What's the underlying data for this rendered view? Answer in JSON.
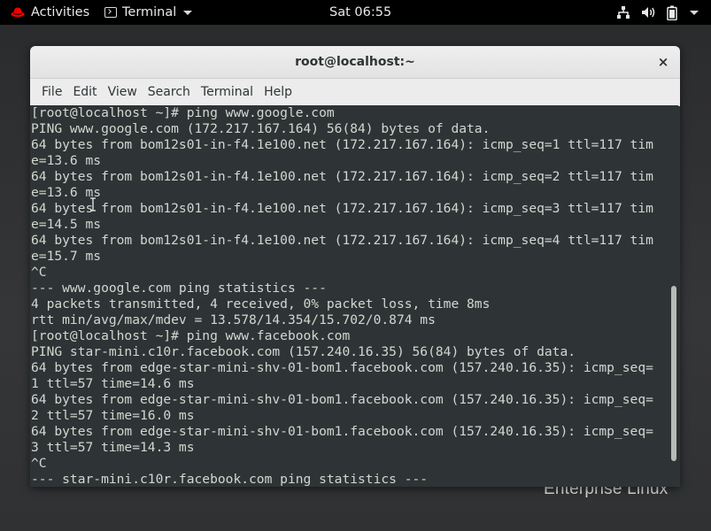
{
  "topbar": {
    "activities_label": "Activities",
    "app_label": "Terminal",
    "clock": "Sat 06:55",
    "icons": [
      "network-icon",
      "volume-icon",
      "battery-icon",
      "power-menu-caret-icon"
    ]
  },
  "window": {
    "title": "root@localhost:~",
    "close_label": "×",
    "menu": [
      "File",
      "Edit",
      "View",
      "Search",
      "Terminal",
      "Help"
    ]
  },
  "terminal": {
    "lines": [
      "[root@localhost ~]# ping www.google.com",
      "PING www.google.com (172.217.167.164) 56(84) bytes of data.",
      "64 bytes from bom12s01-in-f4.1e100.net (172.217.167.164): icmp_seq=1 ttl=117 tim",
      "e=13.6 ms",
      "64 bytes from bom12s01-in-f4.1e100.net (172.217.167.164): icmp_seq=2 ttl=117 tim",
      "e=13.6 ms",
      "64 bytes from bom12s01-in-f4.1e100.net (172.217.167.164): icmp_seq=3 ttl=117 tim",
      "e=14.5 ms",
      "64 bytes from bom12s01-in-f4.1e100.net (172.217.167.164): icmp_seq=4 ttl=117 tim",
      "e=15.7 ms",
      "^C",
      "--- www.google.com ping statistics ---",
      "4 packets transmitted, 4 received, 0% packet loss, time 8ms",
      "rtt min/avg/max/mdev = 13.578/14.354/15.702/0.874 ms",
      "[root@localhost ~]# ping www.facebook.com",
      "PING star-mini.c10r.facebook.com (157.240.16.35) 56(84) bytes of data.",
      "64 bytes from edge-star-mini-shv-01-bom1.facebook.com (157.240.16.35): icmp_seq=",
      "1 ttl=57 time=14.6 ms",
      "64 bytes from edge-star-mini-shv-01-bom1.facebook.com (157.240.16.35): icmp_seq=",
      "2 ttl=57 time=16.0 ms",
      "64 bytes from edge-star-mini-shv-01-bom1.facebook.com (157.240.16.35): icmp_seq=",
      "3 ttl=57 time=14.3 ms",
      "^C",
      "--- star-mini.c10r.facebook.com ping statistics ---"
    ]
  },
  "watermark": "Enterprise Linux",
  "colors": {
    "terminal_bg": "#2e3436",
    "terminal_fg": "#d3d7cf",
    "topbar_bg": "#000000",
    "redhat_red": "#ee0000"
  }
}
